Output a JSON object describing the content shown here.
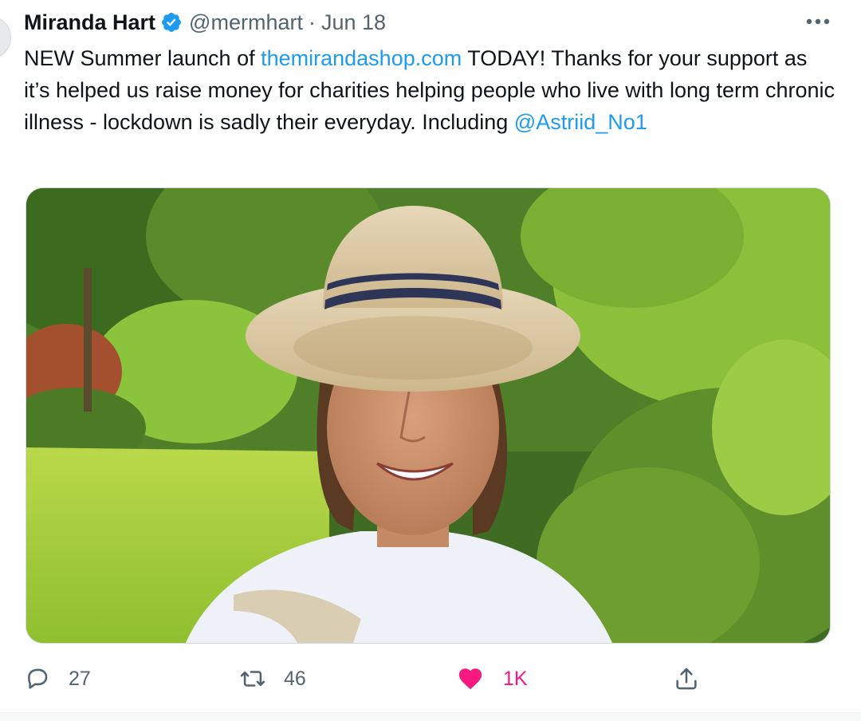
{
  "tweet": {
    "author_name": "Miranda Hart",
    "handle": "@mermhart",
    "separator": "·",
    "date": "Jun 18",
    "text_before_link": "NEW Summer launch of ",
    "link_text": "themirandashop.com",
    "text_after_link": " TODAY! Thanks for your support as it’s helped us raise money for charities helping people who live with long term chronic illness - lockdown is sadly their everyday. Including ",
    "mention": "@Astriid_No1",
    "media_alt": "Photo of a woman wearing a straw hat and white T-shirt in a sunny garden"
  },
  "actions": {
    "replies": "27",
    "retweets": "46",
    "likes": "1K"
  },
  "colors": {
    "accent": "#1d9bf0",
    "like": "#f91880",
    "secondary_text": "#536471"
  },
  "icons": [
    "verified-badge-icon",
    "more-icon",
    "reply-icon",
    "retweet-icon",
    "like-icon",
    "share-icon"
  ]
}
